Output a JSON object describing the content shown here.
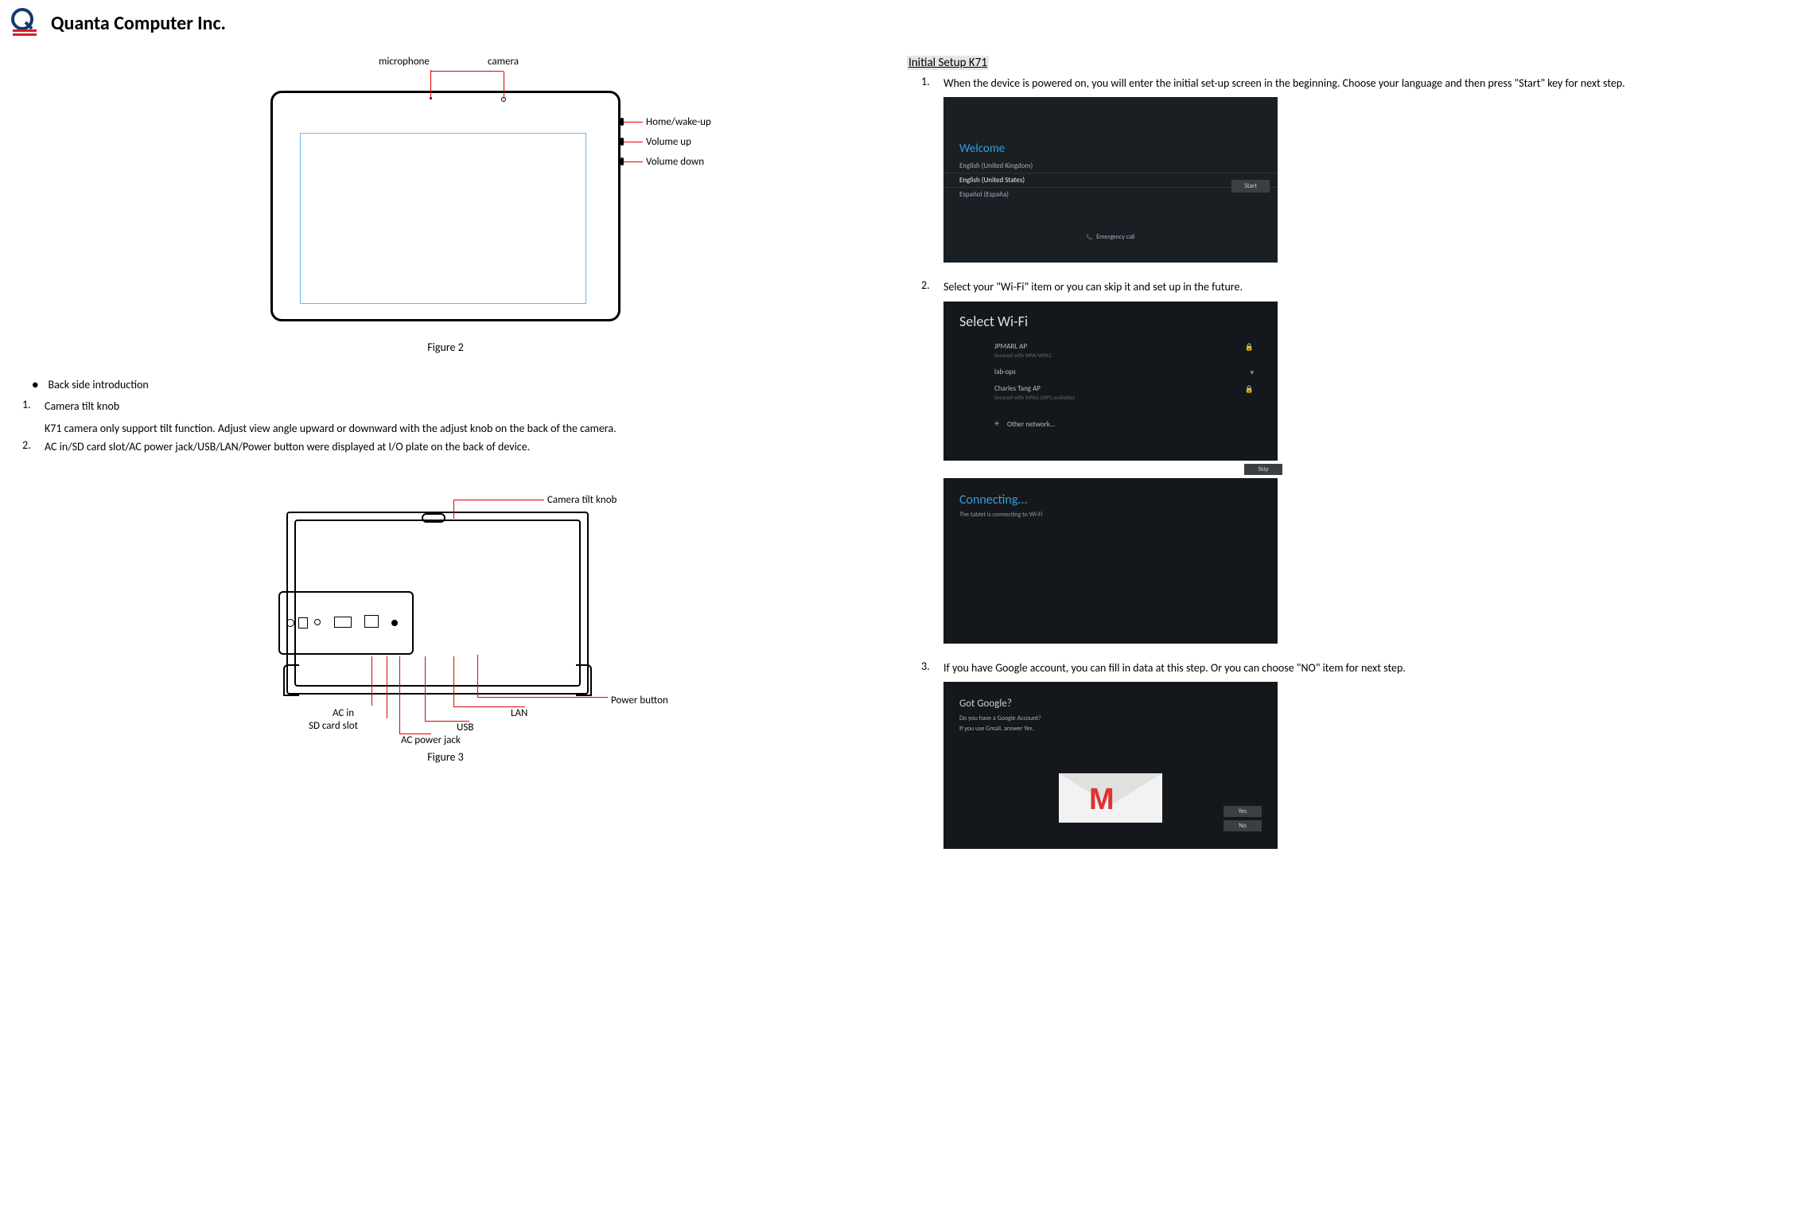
{
  "header": {
    "company": "Quanta Computer Inc."
  },
  "fig2": {
    "caption": "Figure 2",
    "labels": {
      "mic": "microphone",
      "cam": "camera",
      "home": "Home/wake-up",
      "vup": "Volume up",
      "vdown": "Volume down"
    }
  },
  "backside": {
    "title": "Back side introduction",
    "items": [
      {
        "num": "1.",
        "title": "Camera tilt knob",
        "body": "K71 camera only support tilt function.    Adjust view angle upward or downward with the adjust knob on the back of the camera."
      },
      {
        "num": "2.",
        "title": "AC in/SD card slot/AC power jack/USB/LAN/Power button were displayed at I/O plate on the back of device."
      }
    ]
  },
  "fig3": {
    "caption": "Figure 3",
    "labels": {
      "knob": "Camera tilt knob",
      "ac": "AC in",
      "sd": "SD card slot",
      "jack": "AC power jack",
      "usb": "USB",
      "lan": "LAN",
      "pbtn": "Power button"
    }
  },
  "setup": {
    "title": "Initial Setup K71",
    "steps": [
      {
        "num": "1.",
        "text": "When the device is powered on, you will enter the initial set-up screen in the beginning. Choose your language and then press \"Start\" key for next step."
      },
      {
        "num": "2.",
        "text": "Select your \"Wi-Fi\" item or you can skip it and set up in the future."
      },
      {
        "num": "3.",
        "text": "If you have Google account, you can fill in data at this step. Or you can choose \"NO\" item for next step."
      }
    ]
  },
  "shot_welcome": {
    "title": "Welcome",
    "lang_prev": "English (United Kingdom)",
    "lang_sel": "English (United States)",
    "lang_next": "Español (España)",
    "start": "Start",
    "emerg": "Emergency call"
  },
  "shot_wifi": {
    "title": "Select Wi-Fi",
    "net1": "JPMARL AP",
    "net1s": "Secured with WPA/WPA2",
    "net2": "lab-ops",
    "net3": "Charles Tang AP",
    "net3s": "Secured with WPA2 (WPS available)",
    "other": "Other network…",
    "skip": "Skip"
  },
  "shot_connecting": {
    "title": "Connecting...",
    "sub": "The tablet is connecting to Wi-Fi"
  },
  "shot_google": {
    "title": "Got Google?",
    "sub1": "Do you have a Google Account?",
    "sub2": "If you use Gmail, answer Yes.",
    "yes": "Yes",
    "no": "No"
  }
}
